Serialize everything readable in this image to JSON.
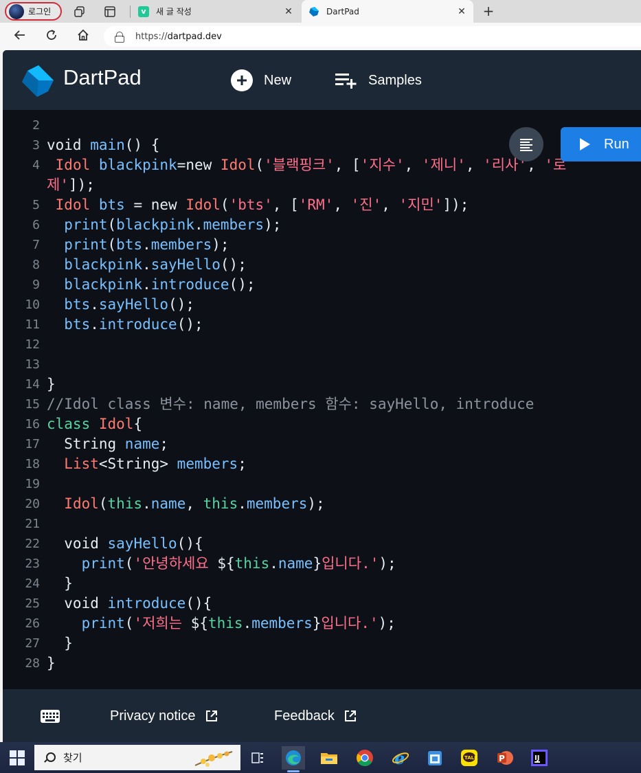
{
  "browser": {
    "profile_label": "로그인",
    "tabs": [
      {
        "title": "새 글 작성",
        "favicon": "velog-icon"
      },
      {
        "title": "DartPad",
        "favicon": "dart-icon"
      }
    ],
    "url_prefix": "https://",
    "url_host": "dartpad.dev"
  },
  "dartpad": {
    "title": "DartPad",
    "new_label": "New",
    "samples_label": "Samples",
    "run_label": "Run",
    "footer": {
      "privacy_label": "Privacy notice",
      "feedback_label": "Feedback"
    }
  },
  "code_lines": [
    {
      "n": "2",
      "tokens": []
    },
    {
      "n": "3",
      "tokens": [
        [
          "kw",
          "void "
        ],
        [
          "pr",
          "main"
        ],
        [
          "kw",
          "() {"
        ]
      ]
    },
    {
      "n": "4",
      "tokens": [
        [
          "kw",
          " "
        ],
        [
          "ty",
          "Idol"
        ],
        [
          "kw",
          " "
        ],
        [
          "pr",
          "blackpink"
        ],
        [
          "kw",
          "="
        ],
        [
          "kw",
          "new "
        ],
        [
          "ty",
          "Idol"
        ],
        [
          "kw",
          "("
        ],
        [
          "st",
          "'블랙핑크'"
        ],
        [
          "kw",
          ", ["
        ],
        [
          "st",
          "'지수'"
        ],
        [
          "kw",
          ", "
        ],
        [
          "st",
          "'제니'"
        ],
        [
          "kw",
          ", "
        ],
        [
          "st",
          "'리사'"
        ],
        [
          "kw",
          ", "
        ],
        [
          "st",
          "'로"
        ]
      ]
    },
    {
      "n": "",
      "tokens": [
        [
          "st",
          "제'"
        ],
        [
          "kw",
          "]);"
        ]
      ]
    },
    {
      "n": "5",
      "tokens": [
        [
          "kw",
          " "
        ],
        [
          "ty",
          "Idol"
        ],
        [
          "kw",
          " "
        ],
        [
          "pr",
          "bts"
        ],
        [
          "kw",
          " = "
        ],
        [
          "kw",
          "new "
        ],
        [
          "ty",
          "Idol"
        ],
        [
          "kw",
          "("
        ],
        [
          "st",
          "'bts'"
        ],
        [
          "kw",
          ", ["
        ],
        [
          "st",
          "'RM'"
        ],
        [
          "kw",
          ", "
        ],
        [
          "st",
          "'진'"
        ],
        [
          "kw",
          ", "
        ],
        [
          "st",
          "'지민'"
        ],
        [
          "kw",
          "]);"
        ]
      ]
    },
    {
      "n": "6",
      "tokens": [
        [
          "kw",
          "  "
        ],
        [
          "fn",
          "print"
        ],
        [
          "kw",
          "("
        ],
        [
          "pr",
          "blackpink"
        ],
        [
          "kw",
          "."
        ],
        [
          "pr",
          "members"
        ],
        [
          "kw",
          ");"
        ]
      ]
    },
    {
      "n": "7",
      "tokens": [
        [
          "kw",
          "  "
        ],
        [
          "fn",
          "print"
        ],
        [
          "kw",
          "("
        ],
        [
          "pr",
          "bts"
        ],
        [
          "kw",
          "."
        ],
        [
          "pr",
          "members"
        ],
        [
          "kw",
          ");"
        ]
      ]
    },
    {
      "n": "8",
      "tokens": [
        [
          "kw",
          "  "
        ],
        [
          "pr",
          "blackpink"
        ],
        [
          "kw",
          "."
        ],
        [
          "fn",
          "sayHello"
        ],
        [
          "kw",
          "();"
        ]
      ]
    },
    {
      "n": "9",
      "tokens": [
        [
          "kw",
          "  "
        ],
        [
          "pr",
          "blackpink"
        ],
        [
          "kw",
          "."
        ],
        [
          "fn",
          "introduce"
        ],
        [
          "kw",
          "();"
        ]
      ]
    },
    {
      "n": "10",
      "tokens": [
        [
          "kw",
          "  "
        ],
        [
          "pr",
          "bts"
        ],
        [
          "kw",
          "."
        ],
        [
          "fn",
          "sayHello"
        ],
        [
          "kw",
          "();"
        ]
      ]
    },
    {
      "n": "11",
      "tokens": [
        [
          "kw",
          "  "
        ],
        [
          "pr",
          "bts"
        ],
        [
          "kw",
          "."
        ],
        [
          "fn",
          "introduce"
        ],
        [
          "kw",
          "();"
        ]
      ]
    },
    {
      "n": "12",
      "tokens": []
    },
    {
      "n": "13",
      "tokens": []
    },
    {
      "n": "14",
      "tokens": [
        [
          "kw",
          "}"
        ]
      ]
    },
    {
      "n": "15",
      "tokens": [
        [
          "cm",
          "//Idol class 변수: name, members 함수: sayHello, introduce"
        ]
      ]
    },
    {
      "n": "16",
      "tokens": [
        [
          "th",
          "class "
        ],
        [
          "ty",
          "Idol"
        ],
        [
          "kw",
          "{"
        ]
      ]
    },
    {
      "n": "17",
      "tokens": [
        [
          "kw",
          "  String "
        ],
        [
          "pr",
          "name"
        ],
        [
          "kw",
          ";"
        ]
      ]
    },
    {
      "n": "18",
      "tokens": [
        [
          "kw",
          "  "
        ],
        [
          "ty",
          "List"
        ],
        [
          "kw",
          "<String> "
        ],
        [
          "pr",
          "members"
        ],
        [
          "kw",
          ";"
        ]
      ]
    },
    {
      "n": "19",
      "tokens": []
    },
    {
      "n": "20",
      "tokens": [
        [
          "kw",
          "  "
        ],
        [
          "ty",
          "Idol"
        ],
        [
          "kw",
          "("
        ],
        [
          "th",
          "this"
        ],
        [
          "kw",
          "."
        ],
        [
          "pr",
          "name"
        ],
        [
          "kw",
          ", "
        ],
        [
          "th",
          "this"
        ],
        [
          "kw",
          "."
        ],
        [
          "pr",
          "members"
        ],
        [
          "kw",
          ");"
        ]
      ]
    },
    {
      "n": "21",
      "tokens": []
    },
    {
      "n": "22",
      "tokens": [
        [
          "kw",
          "  void "
        ],
        [
          "fn",
          "sayHello"
        ],
        [
          "kw",
          "(){"
        ]
      ]
    },
    {
      "n": "23",
      "tokens": [
        [
          "kw",
          "    "
        ],
        [
          "fn",
          "print"
        ],
        [
          "kw",
          "("
        ],
        [
          "st",
          "'안녕하세요 "
        ],
        [
          "kw",
          "${"
        ],
        [
          "th",
          "this"
        ],
        [
          "kw",
          "."
        ],
        [
          "pr",
          "name"
        ],
        [
          "kw",
          "}"
        ],
        [
          "st",
          "입니다.'"
        ],
        [
          "kw",
          ");"
        ]
      ]
    },
    {
      "n": "24",
      "tokens": [
        [
          "kw",
          "  }"
        ]
      ]
    },
    {
      "n": "25",
      "tokens": [
        [
          "kw",
          "  void "
        ],
        [
          "fn",
          "introduce"
        ],
        [
          "kw",
          "(){"
        ]
      ]
    },
    {
      "n": "26",
      "tokens": [
        [
          "kw",
          "    "
        ],
        [
          "fn",
          "print"
        ],
        [
          "kw",
          "("
        ],
        [
          "st",
          "'저희는 "
        ],
        [
          "kw",
          "${"
        ],
        [
          "th",
          "this"
        ],
        [
          "kw",
          "."
        ],
        [
          "pr",
          "members"
        ],
        [
          "kw",
          "}"
        ],
        [
          "st",
          "입니다.'"
        ],
        [
          "kw",
          ");"
        ]
      ]
    },
    {
      "n": "27",
      "tokens": [
        [
          "kw",
          "  }"
        ]
      ]
    },
    {
      "n": "28",
      "tokens": [
        [
          "kw",
          "}"
        ]
      ]
    }
  ],
  "taskbar": {
    "search_label": "찾기"
  },
  "colors": {
    "app_bg": "#0d1117",
    "header_bg": "#1c2835",
    "run_button": "#1d7fe6",
    "string": "#ff6f8a",
    "type": "#ff7b72",
    "identifier": "#79c0ff"
  }
}
